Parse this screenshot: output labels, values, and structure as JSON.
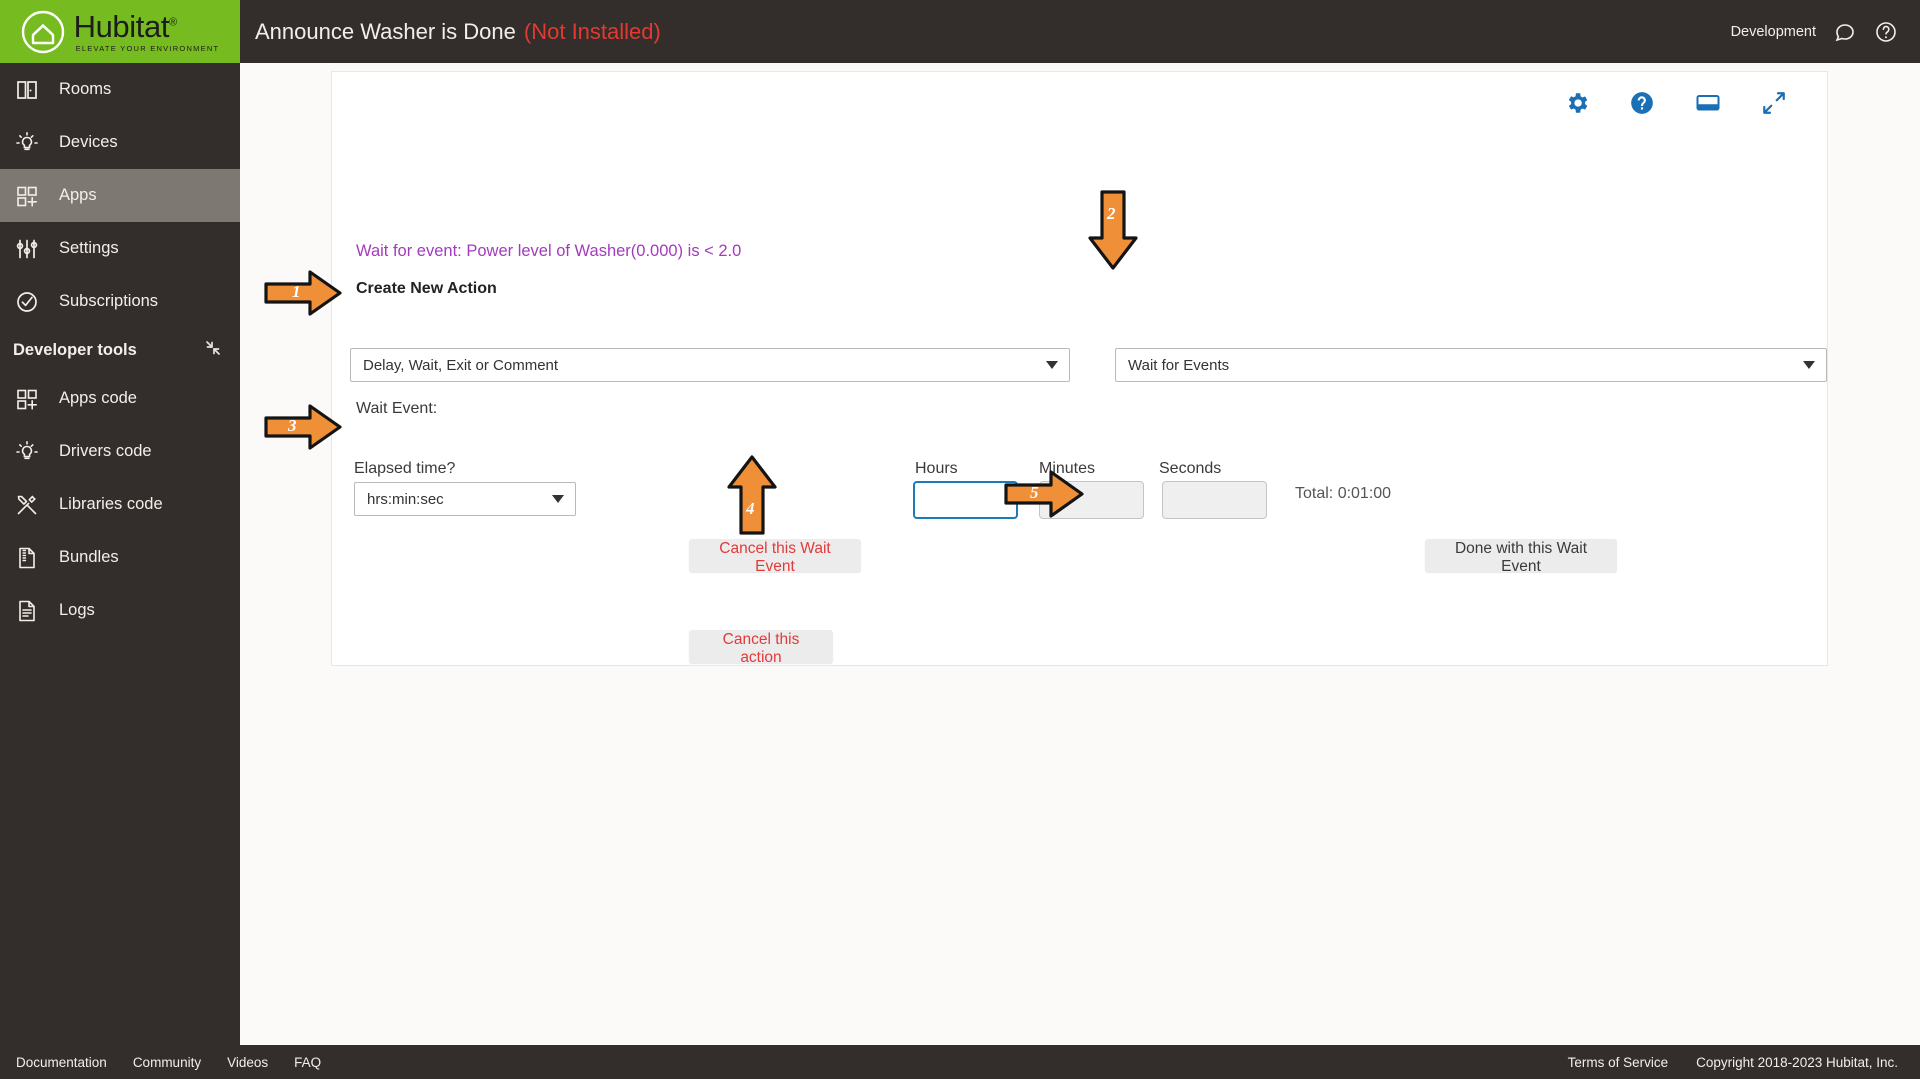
{
  "brand": {
    "name": "Hubitat",
    "registered": "®",
    "tagline": "ELEVATE YOUR ENVIRONMENT"
  },
  "topbar": {
    "title": "Announce Washer is Done",
    "status": "(Not Installed)",
    "env_label": "Development"
  },
  "sidebar": {
    "items": [
      {
        "label": "Rooms",
        "icon": "rooms-icon",
        "active": false
      },
      {
        "label": "Devices",
        "icon": "devices-icon",
        "active": false
      },
      {
        "label": "Apps",
        "icon": "apps-icon",
        "active": true
      },
      {
        "label": "Settings",
        "icon": "settings-icon",
        "active": false
      },
      {
        "label": "Subscriptions",
        "icon": "subscriptions-icon",
        "active": false
      }
    ],
    "section_title": "Developer tools",
    "dev_items": [
      {
        "label": "Apps code",
        "icon": "apps-code-icon"
      },
      {
        "label": "Drivers code",
        "icon": "drivers-code-icon"
      },
      {
        "label": "Libraries code",
        "icon": "libraries-code-icon"
      },
      {
        "label": "Bundles",
        "icon": "bundles-icon"
      },
      {
        "label": "Logs",
        "icon": "logs-icon"
      }
    ]
  },
  "main": {
    "wait_summary": "Wait for event: Power level of Washer(0.000) is < 2.0",
    "create_new_action": "Create New Action",
    "action_select_value": "Delay, Wait, Exit or Comment",
    "type_select_value": "Wait for Events",
    "wait_event_label": "Wait Event:",
    "elapsed_label": "Elapsed time?",
    "elapsed_select_value": "hrs:min:sec",
    "hours_label": "Hours",
    "minutes_label": "Minutes",
    "seconds_label": "Seconds",
    "hours_value": "",
    "minutes_value": "1",
    "seconds_value": "",
    "total_text": "Total: 0:01:00",
    "cancel_wait_label": "Cancel this Wait Event",
    "done_wait_label": "Done with this Wait Event",
    "cancel_action_label": "Cancel this action",
    "card_icons": [
      "gear-icon",
      "help-circle-icon",
      "display-icon",
      "expand-icon"
    ]
  },
  "annotations": [
    {
      "id": "1",
      "direction": "right"
    },
    {
      "id": "2",
      "direction": "down"
    },
    {
      "id": "3",
      "direction": "right"
    },
    {
      "id": "4",
      "direction": "up"
    },
    {
      "id": "5",
      "direction": "right"
    }
  ],
  "footer": {
    "links": [
      "Documentation",
      "Community",
      "Videos",
      "FAQ"
    ],
    "terms": "Terms of Service",
    "copyright": "Copyright 2018-2023 Hubitat, Inc."
  },
  "colors": {
    "brand_green": "#76bc21",
    "dark": "#332e2b",
    "accent_blue": "#1a6fb5",
    "purple": "#a33bbd",
    "danger": "#e03b3b",
    "anno_orange": "#ef9039"
  }
}
